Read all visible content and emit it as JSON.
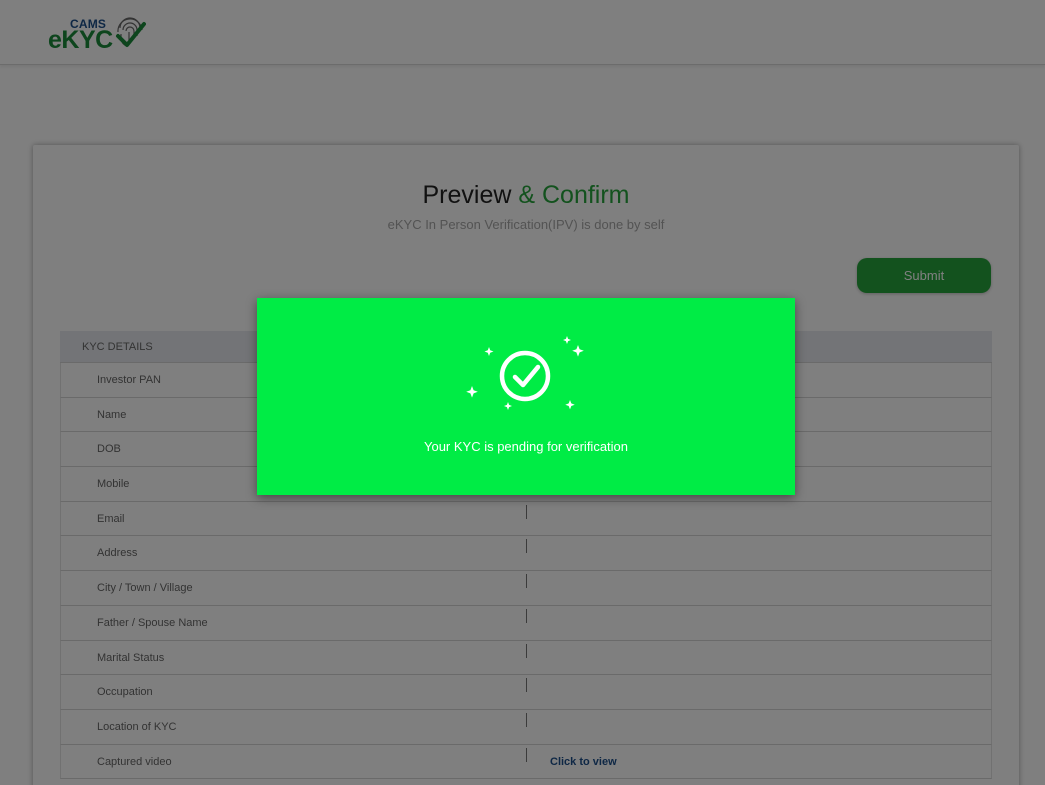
{
  "header": {
    "logo_small": "CAMS",
    "logo_big": "eKYC"
  },
  "page": {
    "title_main": "Preview ",
    "title_accent": "& Confirm",
    "subtitle": "eKYC In Person Verification(IPV) is done by self",
    "submit_label": "Submit",
    "accent_color": "#27a53c"
  },
  "kyc": {
    "section_title": "KYC DETAILS",
    "rows": [
      {
        "label": "Investor PAN",
        "value": ""
      },
      {
        "label": "Name",
        "value": ""
      },
      {
        "label": "DOB",
        "value": ""
      },
      {
        "label": "Mobile",
        "value": ""
      },
      {
        "label": "Email",
        "value": ""
      },
      {
        "label": "Address",
        "value": ""
      },
      {
        "label": "City / Town / Village",
        "value": ""
      },
      {
        "label": "Father / Spouse Name",
        "value": ""
      },
      {
        "label": "Marital Status",
        "value": ""
      },
      {
        "label": "Occupation",
        "value": ""
      },
      {
        "label": "Location of KYC",
        "value": ""
      },
      {
        "label": "Captured video",
        "value": "Click to view"
      }
    ]
  },
  "modal": {
    "message": "Your KYC is pending for verification",
    "icon": "check-circle-sparkles-icon",
    "background": "#00ec45"
  }
}
